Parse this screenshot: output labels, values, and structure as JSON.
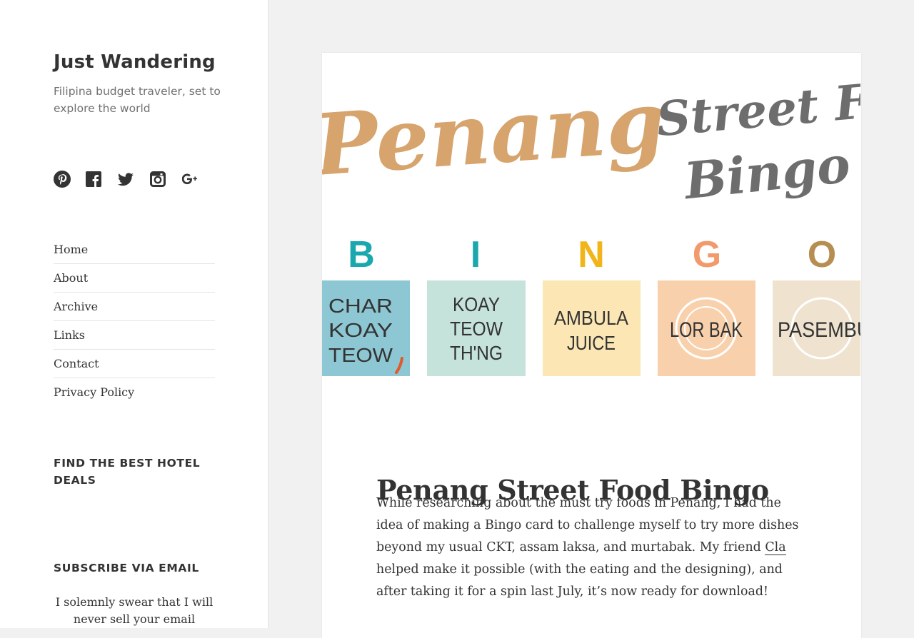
{
  "site": {
    "title": "Just Wandering",
    "tagline": "Filipina budget traveler, set to explore the world"
  },
  "social": [
    {
      "icon": "pinterest-icon"
    },
    {
      "icon": "facebook-icon"
    },
    {
      "icon": "twitter-icon"
    },
    {
      "icon": "instagram-icon"
    },
    {
      "icon": "google-plus-icon"
    }
  ],
  "menu": {
    "items": [
      {
        "label": "Home"
      },
      {
        "label": "About"
      },
      {
        "label": "Archive"
      },
      {
        "label": "Links"
      },
      {
        "label": "Contact"
      },
      {
        "label": "Privacy Policy"
      }
    ]
  },
  "widgets": {
    "hotel_title": "FIND THE BEST HOTEL DEALS",
    "subscribe_title": "SUBSCRIBE VIA EMAIL",
    "subscribe_text": "I solemnly swear that I will never sell your email"
  },
  "hero": {
    "word1": "Penang",
    "word2a": "Street Food",
    "word2b": "Bingo",
    "letters": [
      "B",
      "I",
      "N",
      "G",
      "O"
    ],
    "tiles": [
      {
        "lines": [
          "CHAR",
          "KOAY",
          "TEOW"
        ],
        "color": "#8dc7d4"
      },
      {
        "lines": [
          "KOAY",
          "TEOW",
          "TH'NG"
        ],
        "color": "#c5e3db"
      },
      {
        "lines": [
          "AMBULA",
          "JUICE"
        ],
        "color": "#fbe6b4"
      },
      {
        "lines": [
          "LOR BAK"
        ],
        "color": "#f8d1ac"
      },
      {
        "lines": [
          "PASEMBUR"
        ],
        "color": "#efe3cf"
      }
    ],
    "letter_colors": [
      "#1aa8ae",
      "#1aa8ae",
      "#f2b519",
      "#f29a6b",
      "#b78e52"
    ]
  },
  "post": {
    "title": "Penang Street Food Bingo",
    "body_before": "While researching about the must try foods in Penang, I had the idea of making a Bingo card to challenge myself to try more dishes beyond my usual CKT, assam laksa, and murtabak. My friend ",
    "link_text": "Cla",
    "body_after": " helped make it possible (with the eating and the designing), and after taking it for a spin last July, it’s now ready for download!"
  }
}
